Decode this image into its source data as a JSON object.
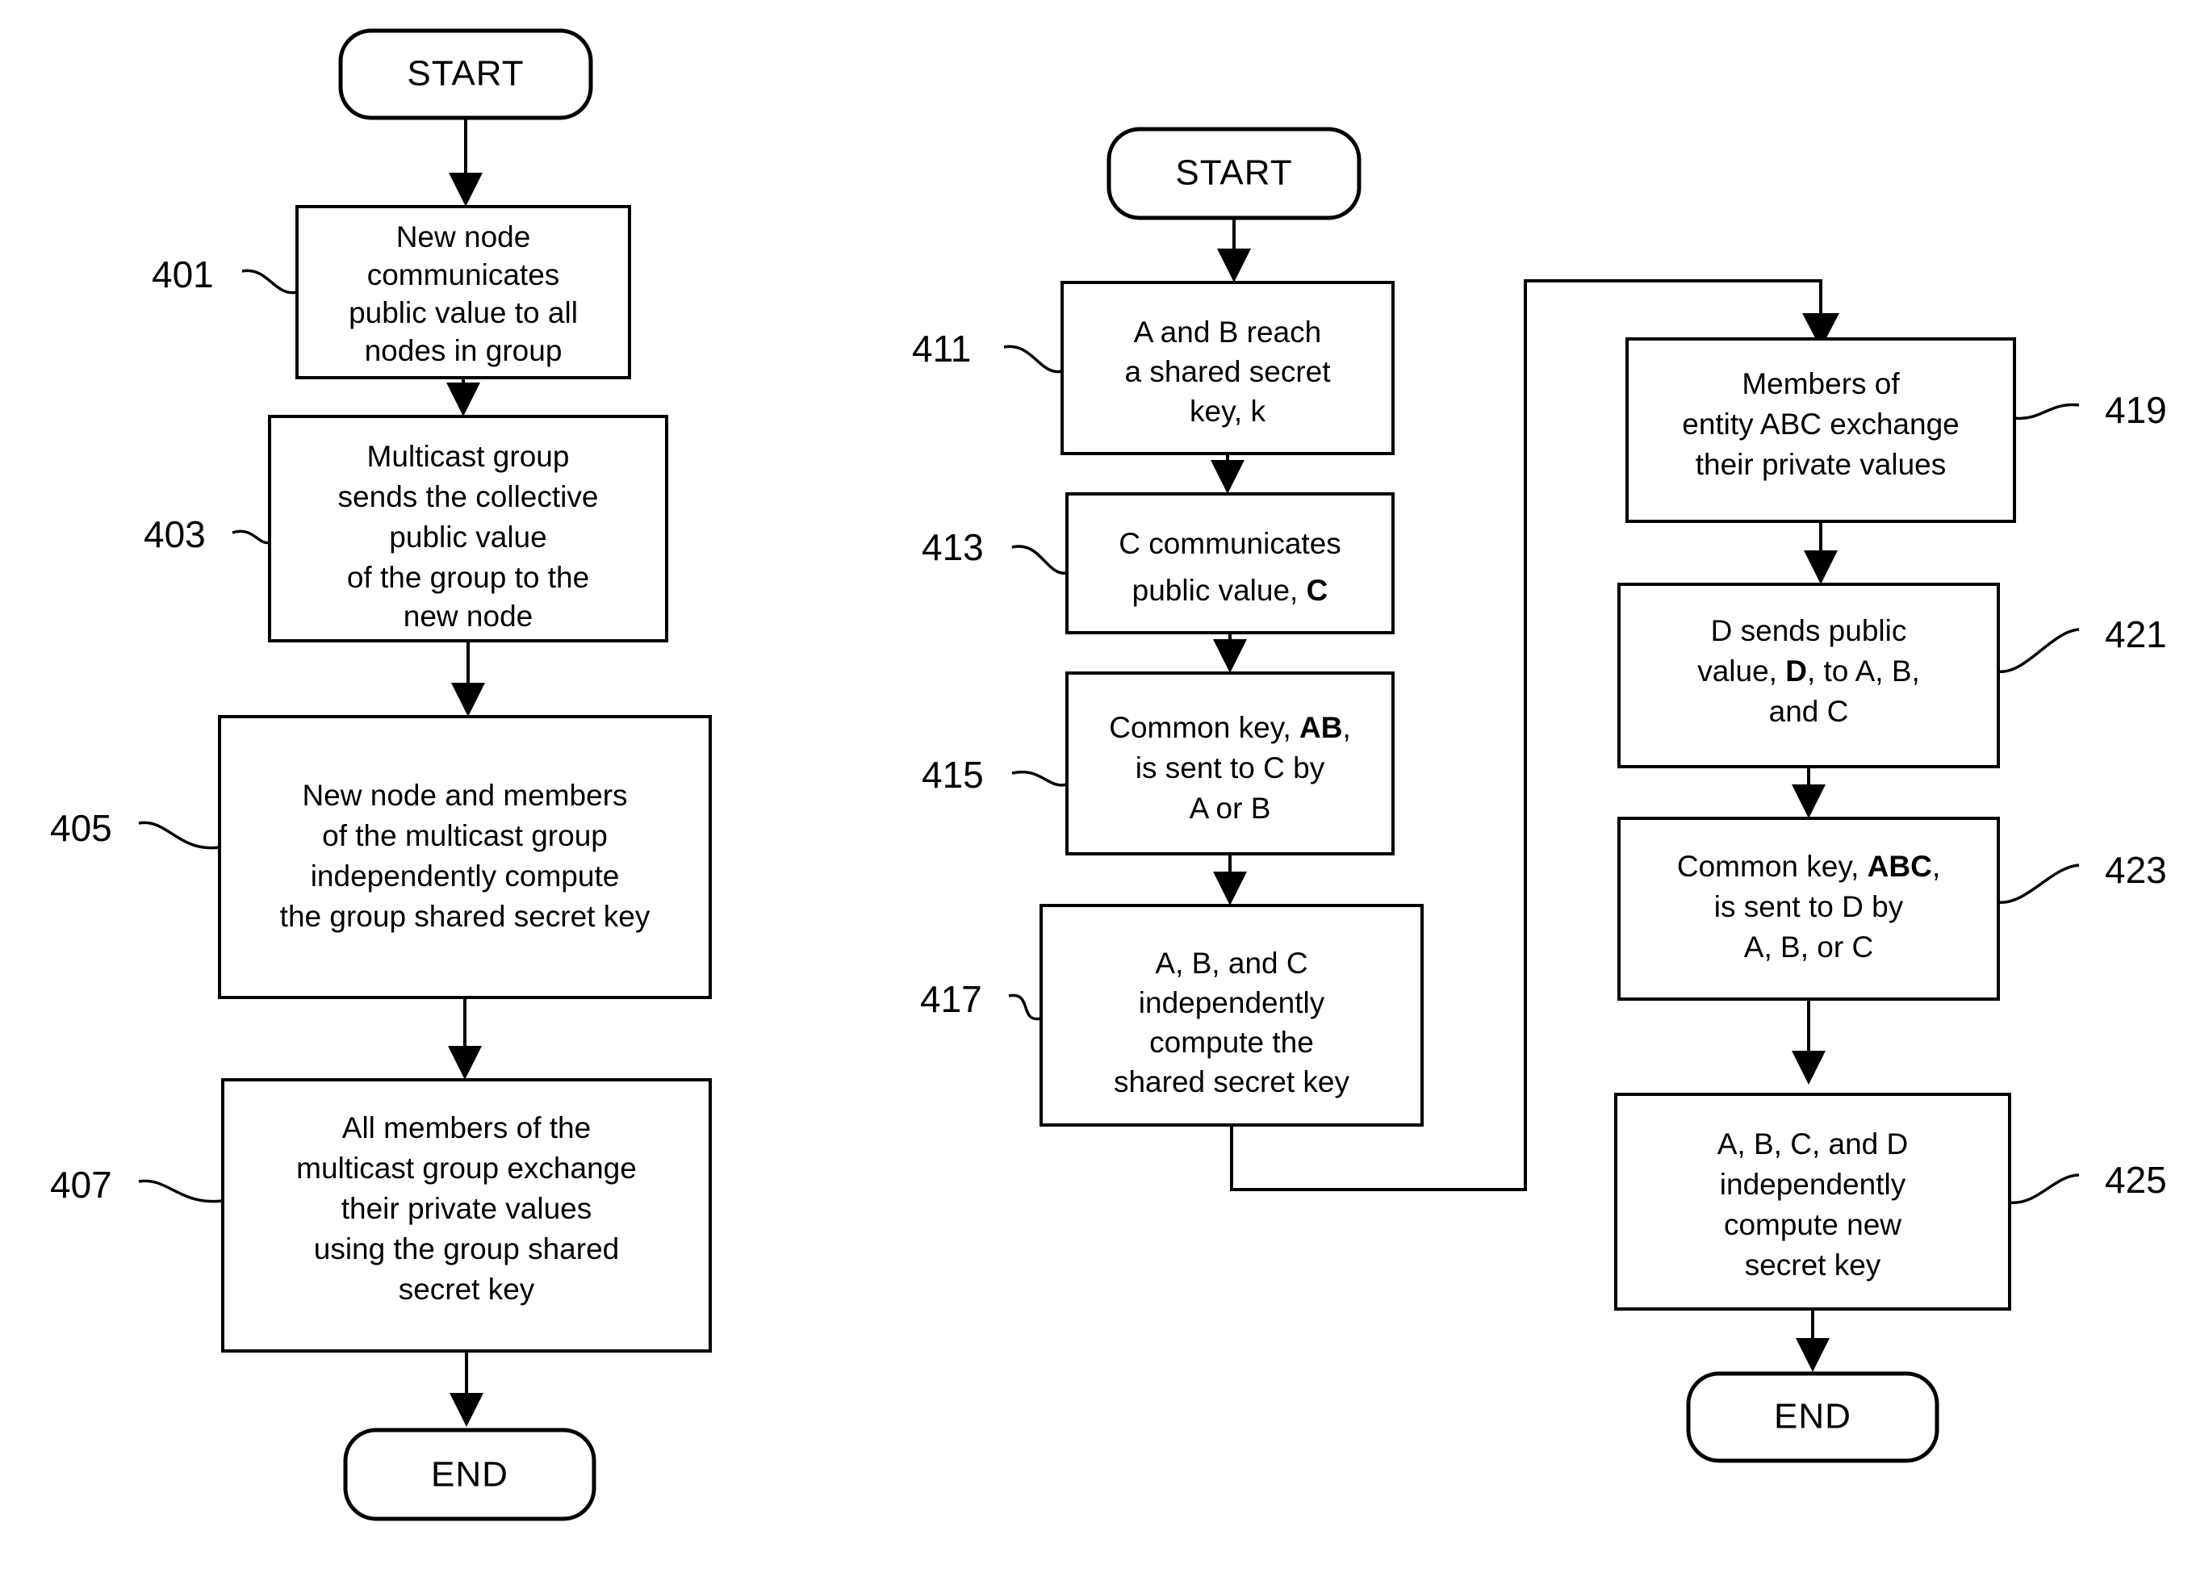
{
  "diagram": {
    "kind": "patent-flowchart",
    "background_color": "#ffffff",
    "line_color": "#000000",
    "columns": [
      {
        "id": "column-left",
        "terminal_start": "START",
        "terminal_end": "END",
        "steps": [
          {
            "ref": "401",
            "lines": [
              "New node",
              "communicates",
              "public value to all",
              "nodes in group"
            ]
          },
          {
            "ref": "403",
            "lines": [
              "Multicast group",
              "sends the collective",
              "public value",
              "of the group to the",
              "new node"
            ]
          },
          {
            "ref": "405",
            "lines": [
              "New node and members",
              "of the multicast group",
              "independently compute",
              "the group shared secret key"
            ]
          },
          {
            "ref": "407",
            "lines": [
              "All members of the",
              "multicast group exchange",
              "their private values",
              "using the group shared",
              "secret key"
            ]
          }
        ]
      },
      {
        "id": "column-middle",
        "terminal_start": "START",
        "terminal_end": "",
        "steps": [
          {
            "ref": "411",
            "lines": [
              "A and B reach",
              "a shared secret",
              "key, k"
            ]
          },
          {
            "ref": "413",
            "lines": [
              "C communicates",
              "public value, C"
            ],
            "bold": [
              "C"
            ]
          },
          {
            "ref": "415",
            "lines": [
              "Common key, AB,",
              "is sent to C by",
              "A or B"
            ],
            "bold": [
              "AB"
            ]
          },
          {
            "ref": "417",
            "lines": [
              "A, B, and C",
              "independently",
              "compute the",
              "shared secret key"
            ]
          }
        ]
      },
      {
        "id": "column-right",
        "terminal_start": "",
        "terminal_end": "END",
        "steps": [
          {
            "ref": "419",
            "lines": [
              "Members of",
              "entity ABC exchange",
              "their private values"
            ]
          },
          {
            "ref": "421",
            "lines": [
              "D sends public",
              "value, D, to A, B,",
              "and C"
            ],
            "bold": [
              "D"
            ]
          },
          {
            "ref": "423",
            "lines": [
              "Common key, ABC,",
              "is sent to D by",
              "A, B, or C"
            ],
            "bold": [
              "ABC"
            ]
          },
          {
            "ref": "425",
            "lines": [
              "A, B, C, and D",
              "independently",
              "compute new",
              "secret key"
            ]
          }
        ]
      }
    ],
    "labels": {
      "start": "START",
      "end": "END",
      "ref_401": "401",
      "ref_403": "403",
      "ref_405": "405",
      "ref_407": "407",
      "ref_411": "411",
      "ref_413": "413",
      "ref_415": "415",
      "ref_417": "417",
      "ref_419": "419",
      "ref_421": "421",
      "ref_423": "423",
      "ref_425": "425"
    },
    "text": {
      "b401_l1": "New node",
      "b401_l2": "communicates",
      "b401_l3": "public value to all",
      "b401_l4": "nodes in group",
      "b403_l1": "Multicast group",
      "b403_l2": "sends the collective",
      "b403_l3": "public value",
      "b403_l4": "of the group to the",
      "b403_l5": "new node",
      "b405_l1": "New node and members",
      "b405_l2": "of the multicast group",
      "b405_l3": "independently compute",
      "b405_l4": "the group shared secret key",
      "b407_l1": "All members of the",
      "b407_l2": "multicast group exchange",
      "b407_l3": "their private values",
      "b407_l4": "using the group shared",
      "b407_l5": "secret key",
      "b411_l1": "A and B reach",
      "b411_l2": "a shared secret",
      "b411_l3": "key, k",
      "b413_l1": "C communicates",
      "b413_l2a": "public value, ",
      "b413_l2b": "C",
      "b415_l1a": "Common key, ",
      "b415_l1b": "AB",
      "b415_l1c": ",",
      "b415_l2": "is sent to C by",
      "b415_l3": "A or B",
      "b417_l1": "A, B, and C",
      "b417_l2": "independently",
      "b417_l3": "compute the",
      "b417_l4": "shared secret key",
      "b419_l1": "Members of",
      "b419_l2": "entity ABC exchange",
      "b419_l3": "their private values",
      "b421_l1": "D sends public",
      "b421_l2a": "value, ",
      "b421_l2b": "D",
      "b421_l2c": ", to A, B,",
      "b421_l3": "and C",
      "b423_l1a": "Common key, ",
      "b423_l1b": "ABC",
      "b423_l1c": ",",
      "b423_l2": "is sent to D by",
      "b423_l3": "A, B, or C",
      "b425_l1": "A, B, C, and D",
      "b425_l2": "independently",
      "b425_l3": "compute new",
      "b425_l4": "secret key",
      "start_left": "START",
      "end_left": "END",
      "start_mid": "START",
      "end_right": "END"
    }
  }
}
